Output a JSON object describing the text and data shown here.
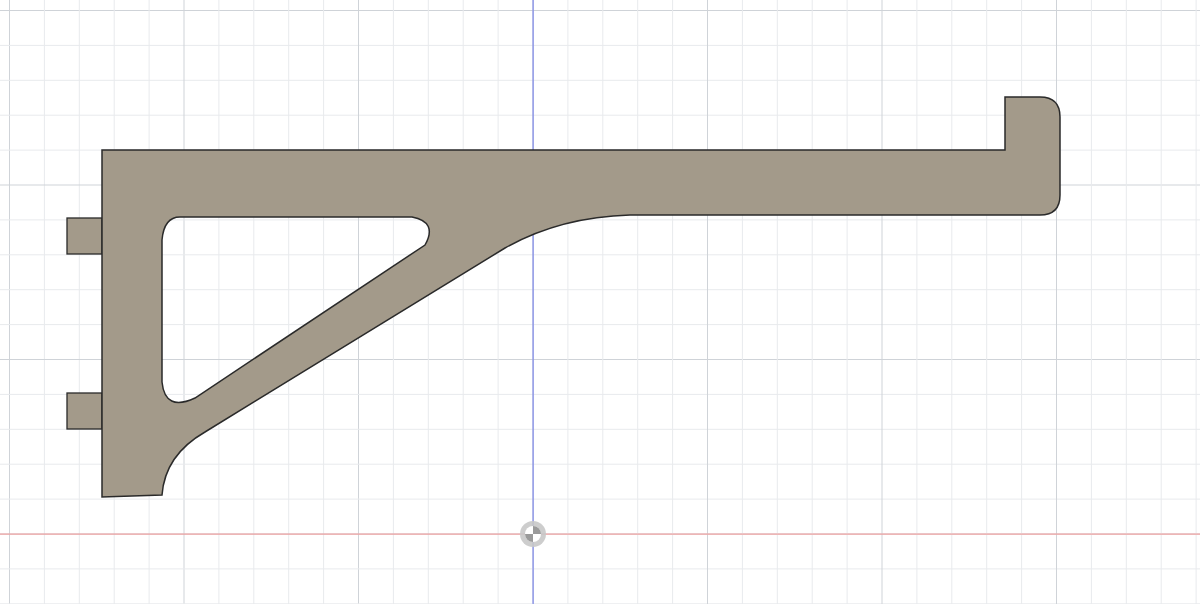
{
  "sketch": {
    "show_grid": true,
    "show_axes": true,
    "show_origin": true
  }
}
